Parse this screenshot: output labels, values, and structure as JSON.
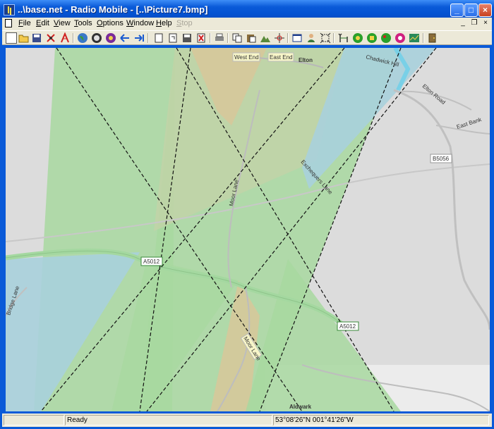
{
  "window": {
    "title": "..\\base.net - Radio Mobile - [..\\Picture7.bmp]"
  },
  "title_buttons": {
    "minimize": "_",
    "maximize": "□",
    "close": "×"
  },
  "menu": {
    "items": [
      {
        "u": "F",
        "rest": "ile"
      },
      {
        "u": "E",
        "rest": "dit"
      },
      {
        "u": "V",
        "rest": "iew"
      },
      {
        "u": "T",
        "rest": "ools"
      },
      {
        "u": "O",
        "rest": "ptions"
      },
      {
        "u": "W",
        "rest": "indow"
      },
      {
        "u": "H",
        "rest": "elp"
      },
      {
        "u": "S",
        "rest": "top"
      }
    ],
    "mdi_controls": [
      "_",
      "❐",
      "×"
    ]
  },
  "toolbar": {
    "icons": [
      "new-file-icon",
      "open-folder-icon",
      "save-icon",
      "network-properties-icon",
      "unit-properties-icon",
      "world-map-icon",
      "map-properties-icon",
      "merge-pictures-icon",
      "back-arrow-icon",
      "forward-arrow-icon",
      "copy-picture-icon",
      "paste-picture-icon",
      "save-picture-icon",
      "delete-picture-icon",
      "print-icon",
      "copy-icon",
      "paste-icon",
      "elevation-grid-icon",
      "center-icon",
      "fit-window-icon",
      "style-icon",
      "zoom-fit-icon",
      "radio-link-icon",
      "polar-coverage-icon",
      "cartesian-coverage-icon",
      "combined-coverage-icon",
      "route-coverage-icon",
      "route-radio-link-icon",
      "exit-icon"
    ]
  },
  "map": {
    "labels": {
      "west_end": "West End",
      "east_end": "East End",
      "elton": "Elton",
      "chadwick_hill": "Chadwick Hill",
      "elton_road": "Elton Road",
      "east_bank": "East Bank",
      "b5056": "B5056",
      "exchequers_lane": "Exchequers Lane",
      "moor_lane_north": "Moor Lane",
      "a5012_west": "A5012",
      "a5012_east": "A5012",
      "moor_lane_south": "Moor Lane",
      "aldwark": "Aldwark",
      "bridge_lane": "Bridge Lane"
    },
    "colors": {
      "green": "#a8d8a0",
      "tan": "#d6c89a",
      "blue": "#a8d0dc",
      "road": "#b8b8b8",
      "a_road": "#a4d8a0"
    }
  },
  "status": {
    "panel1": "",
    "panel2": "Ready",
    "coords": "53°08'26\"N 001°41'26\"W"
  }
}
